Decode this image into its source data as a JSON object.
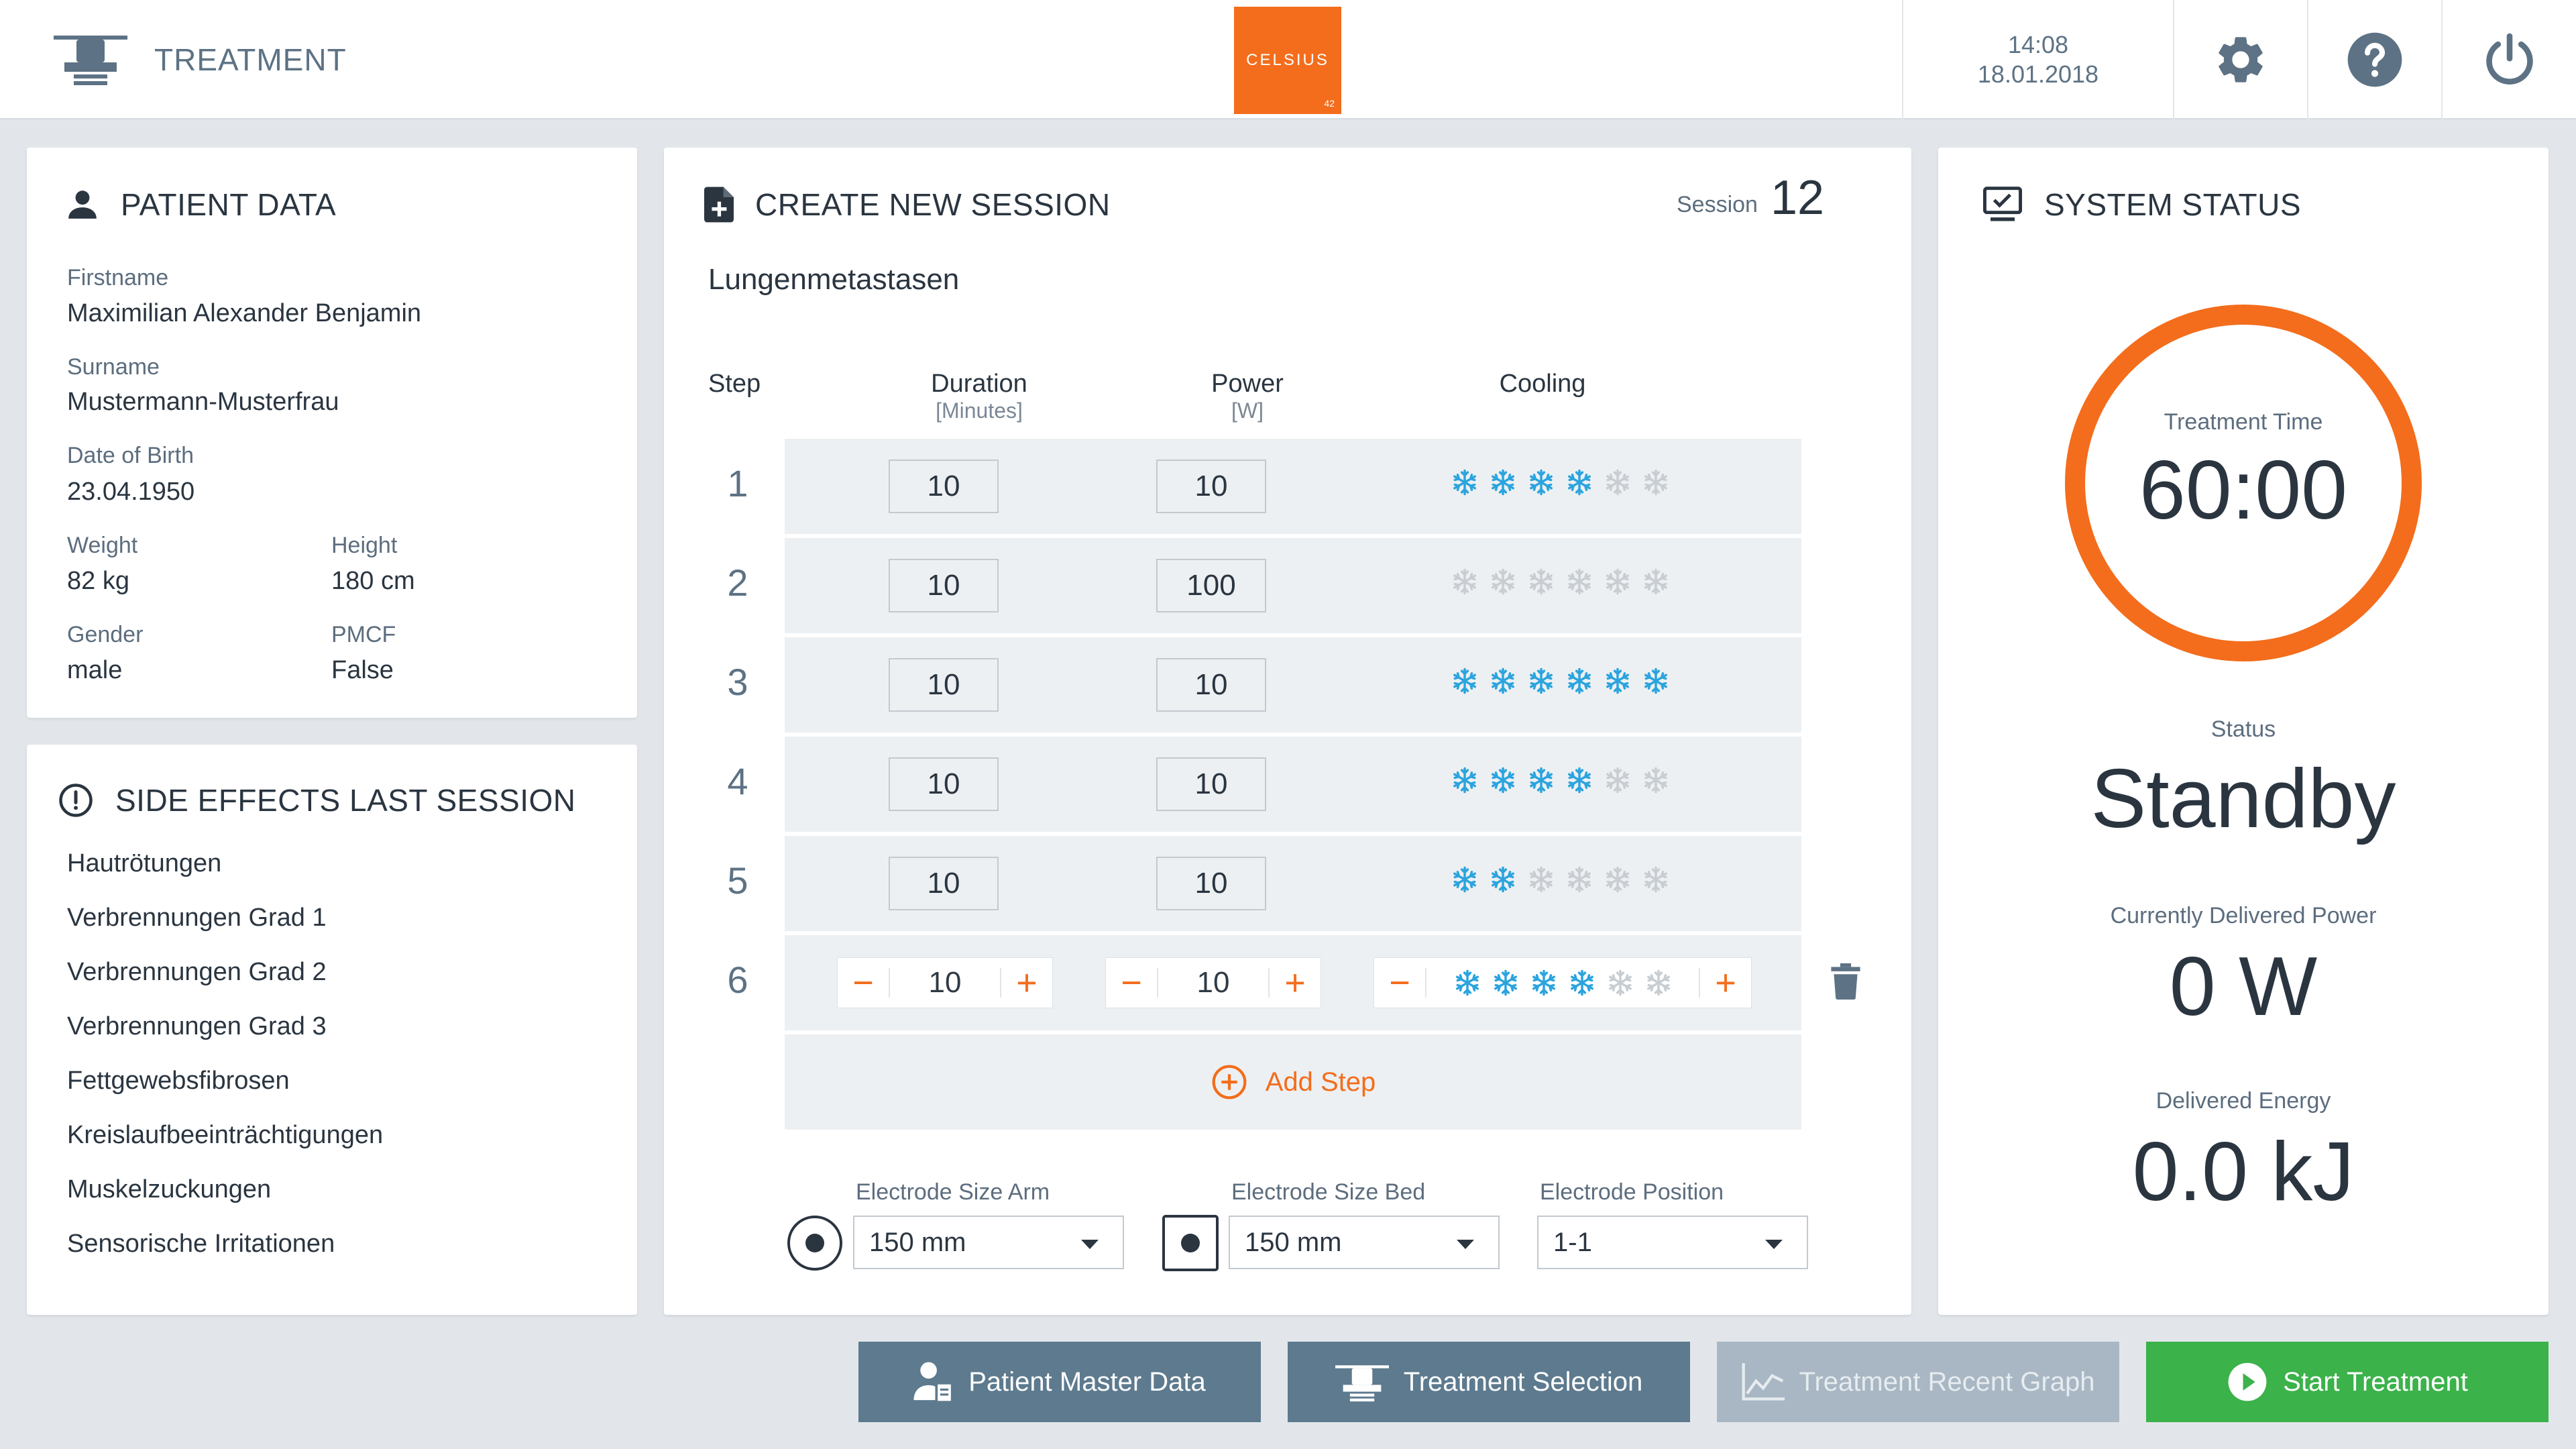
{
  "header": {
    "title": "TREATMENT",
    "logo_text": "CELSIUS",
    "logo_sub": "42",
    "time": "14:08",
    "date": "18.01.2018"
  },
  "patient": {
    "title": "PATIENT DATA",
    "firstname_label": "Firstname",
    "firstname": "Maximilian Alexander Benjamin",
    "surname_label": "Surname",
    "surname": "Mustermann-Musterfrau",
    "dob_label": "Date of Birth",
    "dob": "23.04.1950",
    "weight_label": "Weight",
    "weight": "82 kg",
    "height_label": "Height",
    "height": "180 cm",
    "gender_label": "Gender",
    "gender": "male",
    "pmcf_label": "PMCF",
    "pmcf": "False"
  },
  "side_effects": {
    "title": "SIDE EFFECTS LAST SESSION",
    "items": [
      "Hautrötungen",
      "Verbrennungen Grad 1",
      "Verbrennungen Grad 2",
      "Verbrennungen Grad 3",
      "Fettgewebsfibrosen",
      "Kreislaufbeeinträchtigungen",
      "Muskelzuckungen",
      "Sensorische Irritationen"
    ]
  },
  "session": {
    "title": "CREATE NEW SESSION",
    "number_label": "Session",
    "number": "12",
    "name": "Lungenmetastasen",
    "headers": {
      "step": "Step",
      "duration": "Duration",
      "duration_unit": "[Minutes]",
      "power": "Power",
      "power_unit": "[W]",
      "cooling": "Cooling"
    },
    "steps": [
      {
        "step": "1",
        "duration": "10",
        "power": "10",
        "cooling": 4
      },
      {
        "step": "2",
        "duration": "10",
        "power": "100",
        "cooling": 0
      },
      {
        "step": "3",
        "duration": "10",
        "power": "10",
        "cooling": 6
      },
      {
        "step": "4",
        "duration": "10",
        "power": "10",
        "cooling": 4
      },
      {
        "step": "5",
        "duration": "10",
        "power": "10",
        "cooling": 2
      },
      {
        "step": "6",
        "duration": "10",
        "power": "10",
        "cooling": 4
      }
    ],
    "cooling_max": 6,
    "add_step_label": "Add Step",
    "electrode_arm_label": "Electrode Size Arm",
    "electrode_arm_value": "150 mm",
    "electrode_bed_label": "Electrode Size Bed",
    "electrode_bed_value": "150 mm",
    "electrode_pos_label": "Electrode Position",
    "electrode_pos_value": "1-1"
  },
  "status": {
    "title": "SYSTEM STATUS",
    "treatment_time_label": "Treatment Time",
    "treatment_time": "60:00",
    "status_label": "Status",
    "status": "Standby",
    "power_label": "Currently Delivered Power",
    "power": "0 W",
    "energy_label": "Delivered Energy",
    "energy": "0.0 kJ"
  },
  "buttons": {
    "patient_master": "Patient Master Data",
    "treatment_selection": "Treatment Selection",
    "recent_graph": "Treatment Recent Graph",
    "start": "Start Treatment"
  },
  "colors": {
    "accent": "#f36d1c",
    "cooling_on": "#2ba4de",
    "cooling_off": "#c8cdd2",
    "nav_button": "#5d7a8e",
    "nav_disabled": "#a8b7c3",
    "start_button": "#3bb24a"
  }
}
